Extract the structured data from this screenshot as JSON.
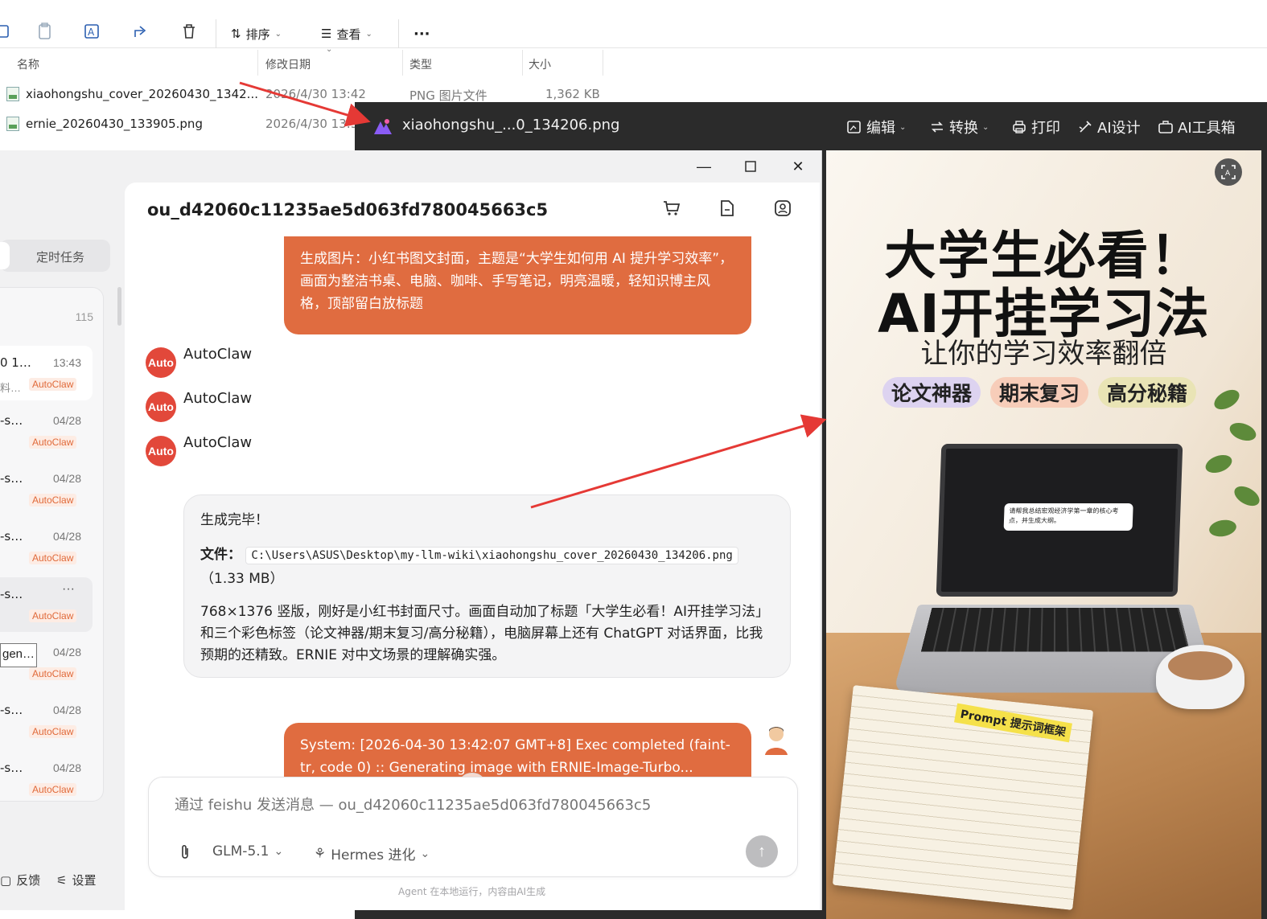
{
  "explorer": {
    "toolbar": {
      "sort_label": "排序",
      "view_label": "查看",
      "more_label": "···"
    },
    "columns": {
      "name": "名称",
      "date": "修改日期",
      "type": "类型",
      "size": "大小"
    },
    "rows": [
      {
        "name": "xiaohongshu_cover_20260430_1342...",
        "date": "2026/4/30 13:42",
        "type": "PNG 图片文件",
        "size": "1,362 KB"
      },
      {
        "name": "ernie_20260430_133905.png",
        "date": "2026/4/30 13:3",
        "type": "",
        "size": ""
      }
    ]
  },
  "viewer": {
    "title": "xiaohongshu_...0_134206.png",
    "tools": {
      "edit": "编辑",
      "convert": "转换",
      "print": "打印",
      "ai_design": "AI设计",
      "ai_tools": "AI工具箱"
    },
    "poster": {
      "title_line1": "大学生必看！",
      "title_line2": "AI开挂学习法",
      "subtitle": "让你的学习效率翻倍",
      "tags": [
        "论文神器",
        "期末复习",
        "高分秘籍"
      ],
      "screen_text": "请帮我总结宏观经济学第一章的核心考点，并生成大纲。",
      "notebook_label": "Prompt 提示词框架"
    }
  },
  "app": {
    "sidebar": {
      "tab_scheduled": "定时任务",
      "count": "115",
      "items": [
        {
          "title": "0 1…",
          "date": "13:43",
          "sub": "料…",
          "badge": "AutoClaw"
        },
        {
          "title": "-s…",
          "date": "04/28",
          "sub": "",
          "badge": "AutoClaw"
        },
        {
          "title": "-s…",
          "date": "04/28",
          "sub": "",
          "badge": "AutoClaw"
        },
        {
          "title": "-s…",
          "date": "04/28",
          "sub": "",
          "badge": "AutoClaw"
        },
        {
          "title": "-s…",
          "date": "",
          "sub": "",
          "badge": "AutoClaw",
          "more": "···"
        },
        {
          "title": "gen…",
          "date": "04/28",
          "sub": "",
          "badge": "AutoClaw"
        },
        {
          "title": "-s…",
          "date": "04/28",
          "sub": "",
          "badge": "AutoClaw"
        },
        {
          "title": "-s…",
          "date": "04/28",
          "sub": "",
          "badge": "AutoClaw"
        }
      ],
      "feedback": "反馈",
      "settings": "设置"
    },
    "chat": {
      "title": "ou_d42060c11235ae5d063fd780045663c5",
      "user_message_1": "生成图片：小红书图文封面，主题是“大学生如何用 AI 提升学习效率”，画面为整洁书桌、电脑、咖啡、手写笔记，明亮温暖，轻知识博主风格，顶部留白放标题",
      "agent_name": "AutoClaw",
      "avatar_label": "Auto",
      "bot_reply": {
        "heading": "生成完毕！",
        "file_label": "文件：",
        "file_path": "C:\\Users\\ASUS\\Desktop\\my-llm-wiki\\xiaohongshu_cover_20260430_134206.png",
        "file_size": "（1.33 MB）",
        "body": "768×1376 竖版，刚好是小红书封面尺寸。画面自动加了标题「大学生必看！AI开挂学习法」和三个彩色标签（论文神器/期末复习/高分秘籍），电脑屏幕上还有 ChatGPT 对话界面，比我预期的还精致。ERNIE 对中文场景的理解确实强。"
      },
      "user_message_2": "System: [2026-04-30 13:42:07 GMT+8] Exec completed (faint-tr, code 0) :: Generating image with ERNIE-Image-Turbo... Prompt: \"C������c�k��椦",
      "composer": {
        "placeholder": "通过 feishu 发送消息 — ou_d42060c11235ae5d063fd780045663c5",
        "model": "GLM-5.1",
        "mode": "Hermes 进化"
      },
      "footnote": "Agent 在本地运行，内容由AI生成"
    }
  },
  "colors": {
    "accent": "#e06c40",
    "arrow": "#e53935",
    "viewer_bg": "#2b2b2b"
  }
}
